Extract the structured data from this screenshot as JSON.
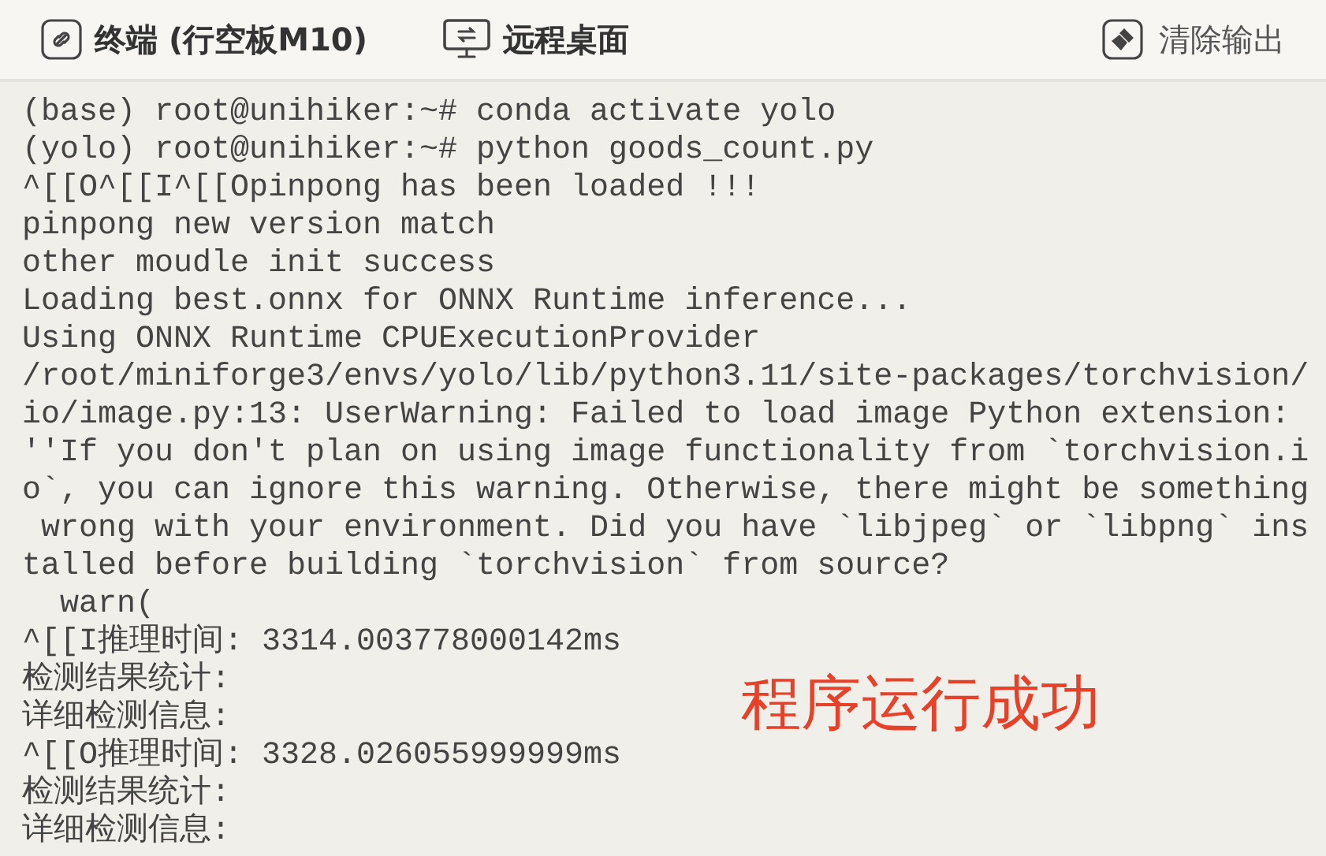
{
  "toolbar": {
    "tabs": [
      {
        "label": "终端 (行空板M10)",
        "kind": "terminal"
      },
      {
        "label": "远程桌面",
        "kind": "desktop"
      }
    ],
    "clear_button": {
      "label": "清除输出"
    }
  },
  "terminal": {
    "lines": [
      "(base) root@unihiker:~# conda activate yolo",
      "(yolo) root@unihiker:~# python goods_count.py",
      "^[[O^[[I^[[Opinpong has been loaded !!!",
      "pinpong new version match",
      "other moudle init success",
      "Loading best.onnx for ONNX Runtime inference...",
      "Using ONNX Runtime CPUExecutionProvider",
      "/root/miniforge3/envs/yolo/lib/python3.11/site-packages/torchvision/",
      "io/image.py:13: UserWarning: Failed to load image Python extension:",
      "''If you don't plan on using image functionality from `torchvision.i",
      "o`, you can ignore this warning. Otherwise, there might be something",
      " wrong with your environment. Did you have `libjpeg` or `libpng` ins",
      "talled before building `torchvision` from source?",
      "  warn(",
      "^[[I推理时间: 3314.003778000142ms",
      "检测结果统计:",
      "详细检测信息:",
      "^[[O推理时间: 3328.026055999999ms",
      "检测结果统计:",
      "详细检测信息:"
    ]
  },
  "annotation": "程序运行成功"
}
